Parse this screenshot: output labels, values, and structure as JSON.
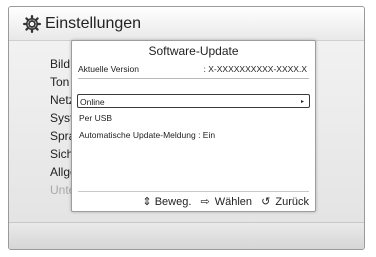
{
  "header": {
    "title": "Einstellungen",
    "icon": "gear-icon"
  },
  "sidebar": {
    "items": [
      {
        "label": "Bild"
      },
      {
        "label": "Ton"
      },
      {
        "label": "Netzw"
      },
      {
        "label": "Syste"
      },
      {
        "label": "Sprac"
      },
      {
        "label": "Siche"
      },
      {
        "label": "Allger"
      },
      {
        "label": "Unter"
      }
    ]
  },
  "dialog": {
    "title": "Software-Update",
    "version_label": "Aktuelle Version",
    "version_value": ": X-XXXXXXXXXX-XXXX.X",
    "options": [
      {
        "label": "Online",
        "selected": true,
        "arrow": "▸"
      },
      {
        "label": "Per USB"
      },
      {
        "label": "Automatische Update-Meldung : Ein"
      }
    ]
  },
  "footer": {
    "move_icon": "⇕",
    "move_label": "Beweg.",
    "select_icon": "⇨",
    "select_label": "Wählen",
    "back_icon": "↺",
    "back_label": "Zurück"
  }
}
